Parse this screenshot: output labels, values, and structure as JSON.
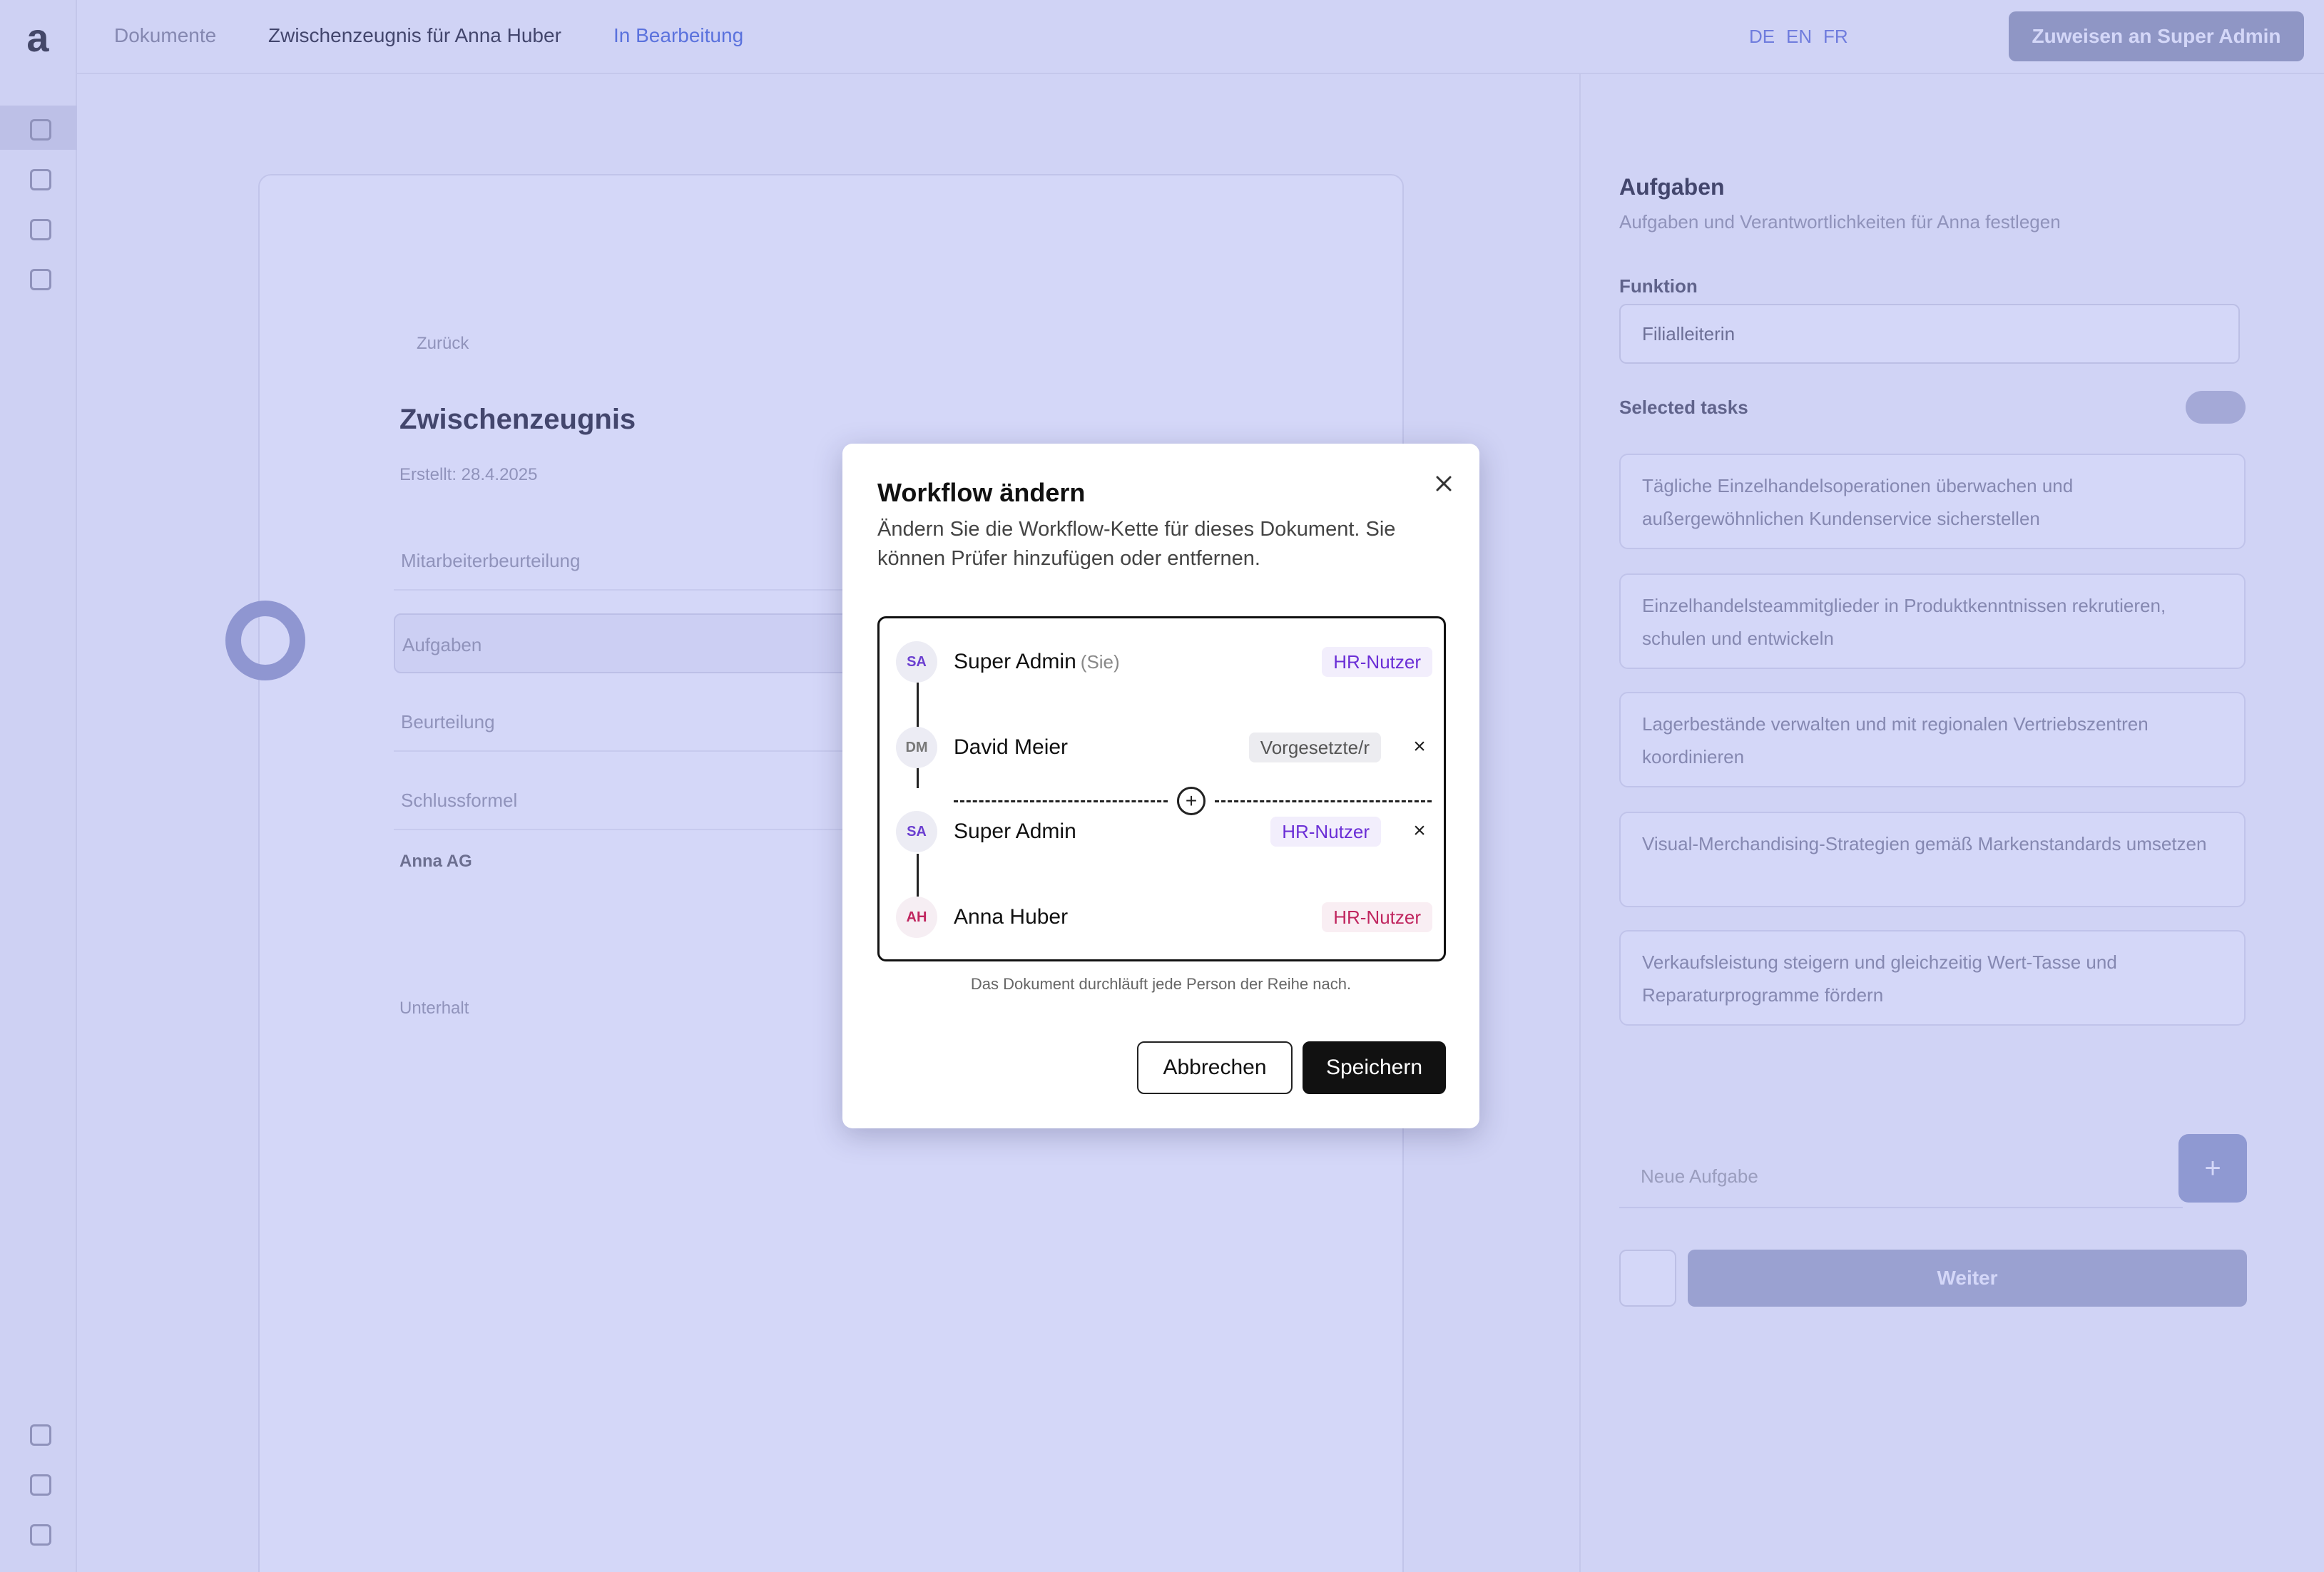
{
  "app": {
    "logo": "a",
    "breadcrumb": {
      "parent": "Dokumente",
      "document": "Zwischenzeugnis für Anna Huber",
      "status": "In Bearbeitung"
    },
    "top_icons": [
      "DE",
      "EN",
      "FR"
    ],
    "assign_button": "Zuweisen an Super Admin"
  },
  "document": {
    "back": "Zurück",
    "title": "Zwischenzeugnis",
    "date": "Erstellt: 28.4.2025",
    "fields": [
      "Mitarbeiterbeurteilung",
      "Aufgaben",
      "Beurteilung",
      "Schlussformel"
    ],
    "section": "Anna AG",
    "footer": "Unterhalt"
  },
  "right_panel": {
    "title": "Aufgaben",
    "subtitle": "Aufgaben und Verantwortlichkeiten für Anna festlegen",
    "function_label": "Funktion",
    "function_value": "Filialleiterin",
    "selected_label": "Selected tasks",
    "tasks": [
      "Tägliche Einzelhandelsoperationen überwachen und außergewöhnlichen Kundenservice sicherstellen",
      "Einzelhandelsteammitglieder in Produktkenntnissen rekrutieren, schulen und entwickeln",
      "Lagerbestände verwalten und mit regionalen Vertriebszentren koordinieren",
      "Visual-Merchandising-Strategien gemäß Markenstandards umsetzen",
      "Verkaufsleistung steigern und gleichzeitig Wert-Tasse und Reparaturprogramme fördern"
    ],
    "input_placeholder": "Neue Aufgabe",
    "next_button": "Weiter"
  },
  "modal": {
    "title": "Workflow ändern",
    "description": "Ändern Sie die Workflow-Kette für dieses Dokument. Sie können Prüfer hinzufügen oder entfernen.",
    "you_label": "(Sie)",
    "chain": [
      {
        "initials": "SA",
        "name": "Super Admin",
        "is_you": true,
        "role": "HR-Nutzer",
        "removable": false
      },
      {
        "initials": "DM",
        "name": "David Meier",
        "is_you": false,
        "role": "Vorgesetzte/r",
        "removable": true
      },
      {
        "initials": "SA",
        "name": "Super Admin",
        "is_you": false,
        "role": "HR-Nutzer",
        "removable": true
      },
      {
        "initials": "AH",
        "name": "Anna Huber",
        "is_you": false,
        "role": "HR-Nutzer",
        "removable": false
      }
    ],
    "remove_glyph": "×",
    "insert_glyph": "+",
    "hint": "Das Dokument durchläuft jede Person der Reihe nach.",
    "cancel_label": "Abbrechen",
    "save_label": "Speichern"
  },
  "colors": {
    "overlay": "#7882e8",
    "role_hr": "#6b2fd6",
    "role_hr_final": "#c0265f",
    "role_supervisor": "#555555",
    "primary_button": "#111111"
  }
}
